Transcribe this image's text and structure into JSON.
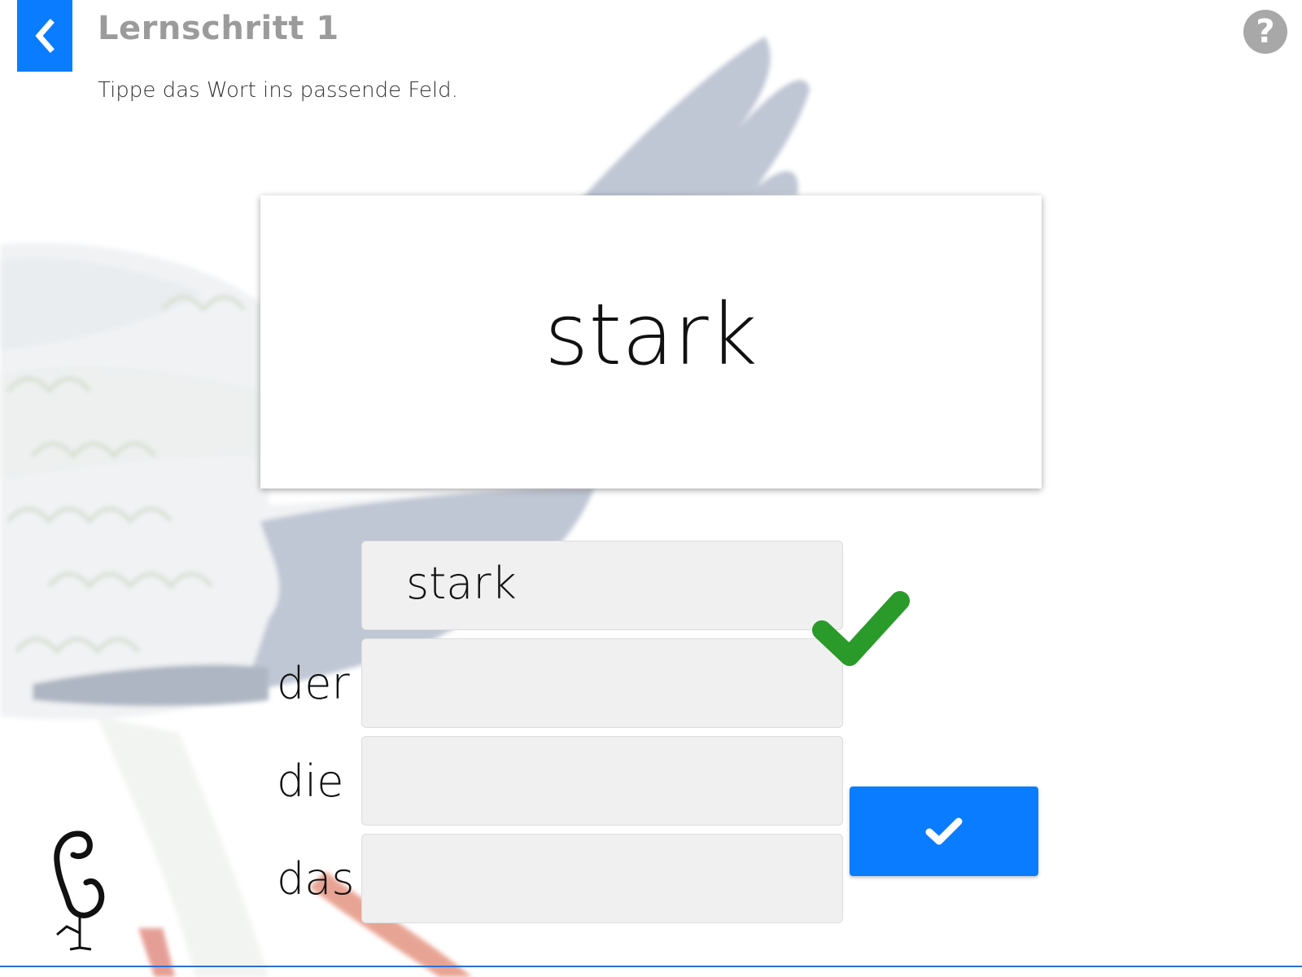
{
  "header": {
    "back_icon": "chevron-left-icon",
    "title": "Lernschritt 1",
    "instruction": "Tippe das Wort ins passende Feld.",
    "help_icon": "question-icon",
    "help_glyph": "?"
  },
  "exercise": {
    "word": "stark",
    "answer_value": "stark",
    "articles": [
      "der",
      "die",
      "das"
    ],
    "result_icon": "checkmark-icon",
    "submit_icon": "checkmark-icon"
  },
  "colors": {
    "accent": "#0a7cff",
    "correct": "#2a9a2a",
    "help": "#a8a8a8"
  }
}
